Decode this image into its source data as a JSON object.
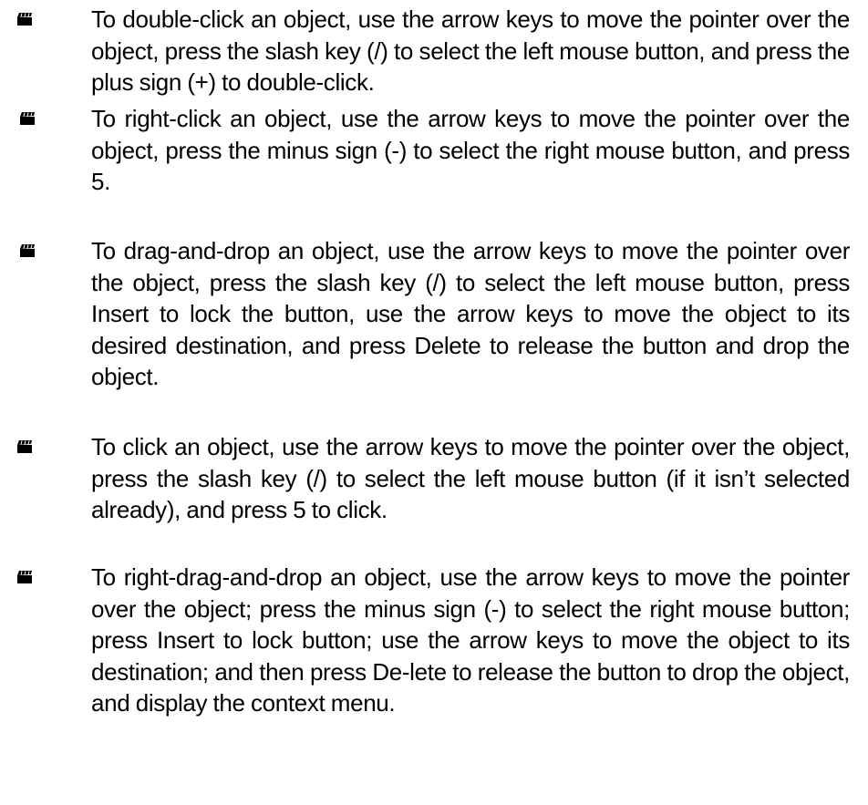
{
  "bullets": [
    {
      "icon": "clapperboard-icon",
      "text": "To double-click an object, use the arrow keys to move the pointer over the object, press the slash key (/) to select the left mouse button, and press the plus sign (+) to double-click."
    },
    {
      "icon": "clapperboard-icon",
      "text": "To right-click an object, use the arrow keys to move the pointer over the object, press the minus sign (-) to select the right mouse button, and press 5."
    },
    {
      "icon": "clapperboard-icon",
      "text": "To drag-and-drop an object, use the arrow keys to move the pointer over the object, press the slash key (/) to select the left mouse button, press Insert to lock the button, use the arrow keys to move the object to its desired destination, and press Delete to release the button and drop the object."
    },
    {
      "icon": "clapperboard-icon",
      "text": "To click an object, use the arrow keys to move the pointer over the object, press the slash key (/) to select the left mouse button (if it isn’t selected already), and press 5 to click."
    },
    {
      "icon": "clapperboard-icon",
      "text": "To right-drag-and-drop an object, use the arrow keys to move the pointer over the object; press the minus sign (-) to select the right mouse button; press Insert to lock button; use the arrow keys to move the object to its destination; and then press De-lete to release the button to drop the object, and display the context menu."
    }
  ]
}
